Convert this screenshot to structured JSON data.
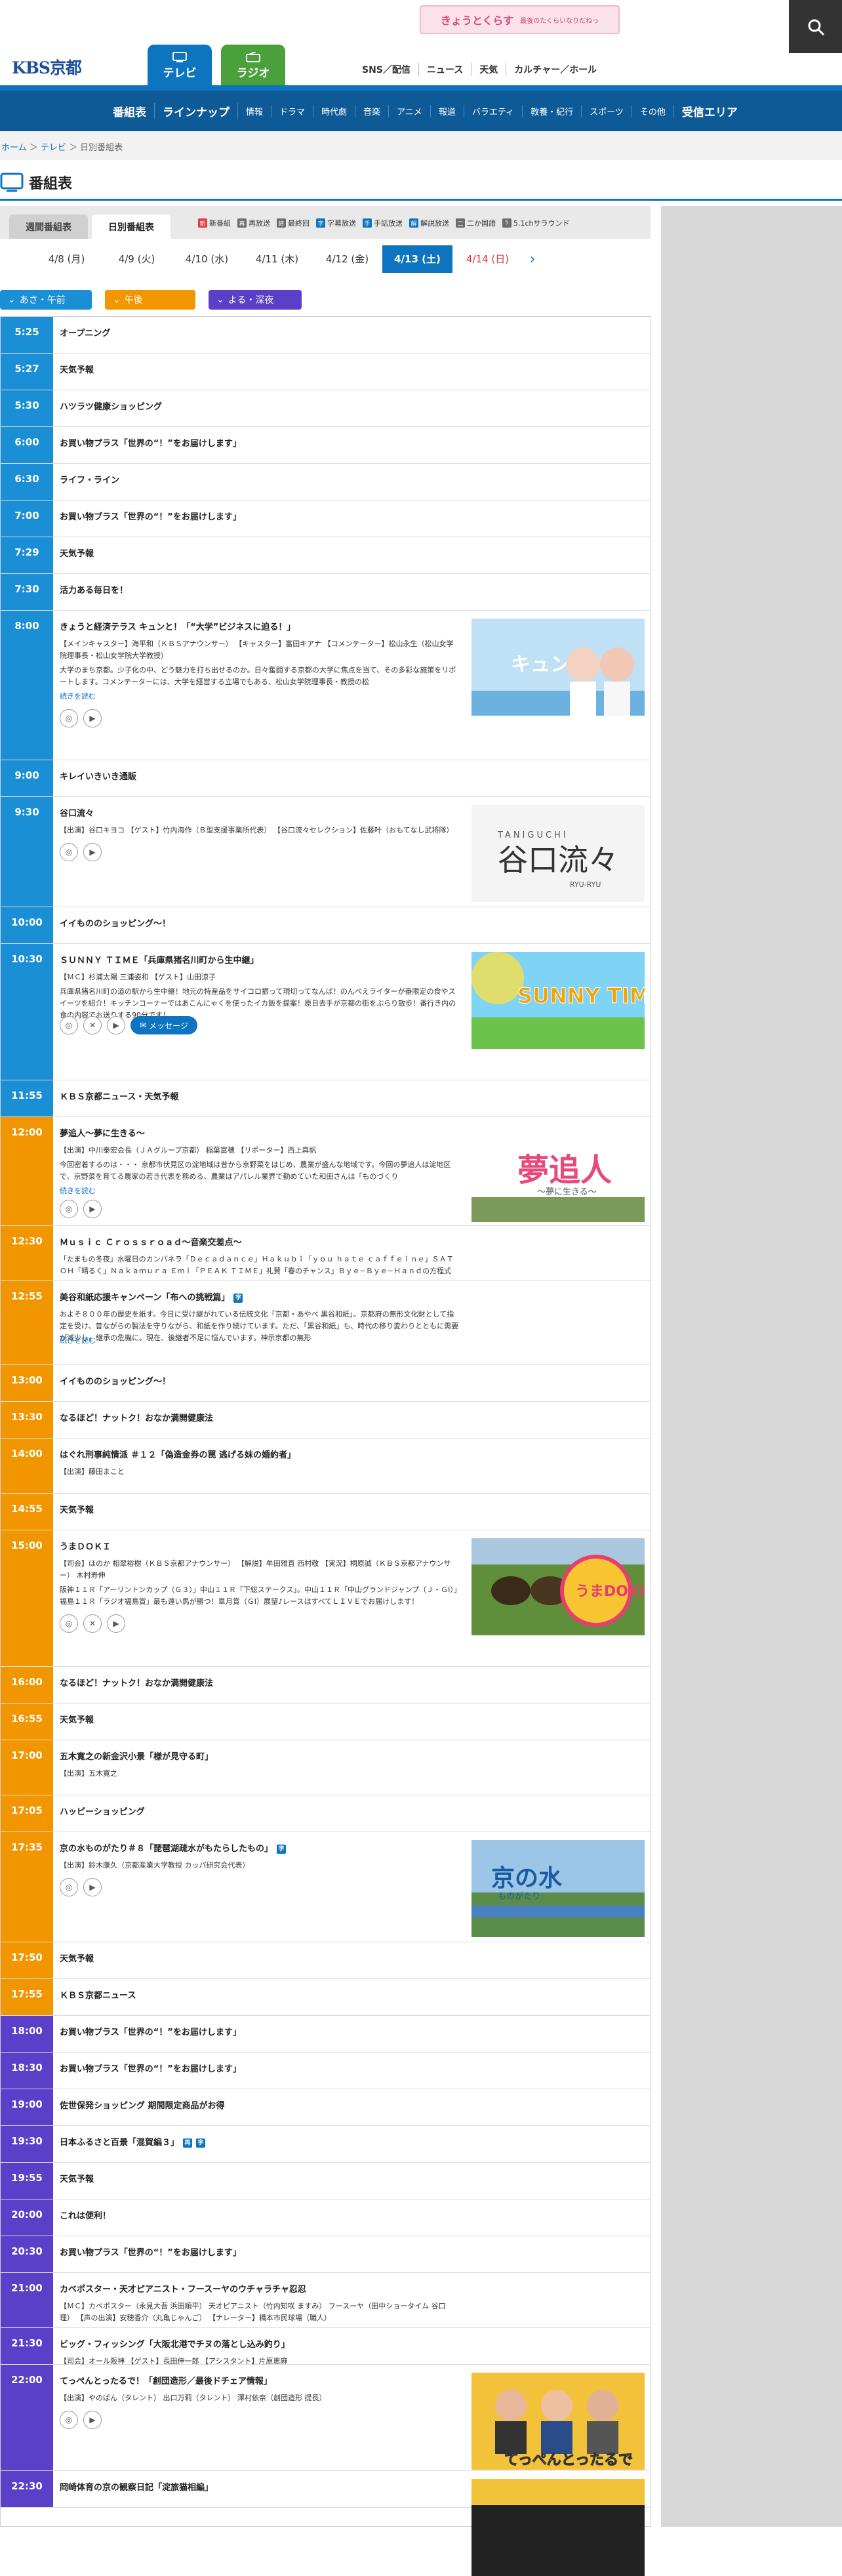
{
  "header": {
    "banner_main": "きょうとくらす",
    "banner_sub": "最後のたくらいなりだねっ",
    "logo": "KBS京都",
    "tab_tv": "テレビ",
    "tab_radio": "ラジオ",
    "nav": [
      "SNS／配信",
      "ニュース",
      "天気",
      "カルチャー／ホール"
    ]
  },
  "category_nav": [
    "番組表",
    "ラインナップ",
    "情報",
    "ドラマ",
    "時代劇",
    "音楽",
    "アニメ",
    "報道",
    "バラエティ",
    "教養・紀行",
    "スポーツ",
    "その他",
    "受信エリア"
  ],
  "breadcrumb": [
    "ホーム",
    "テレビ",
    "日別番組表"
  ],
  "page_title": "番組表",
  "sub_tabs": [
    "週間番組表",
    "日別番組表"
  ],
  "legend": [
    {
      "mark": "新",
      "label": "新番組",
      "color": "#e8383d"
    },
    {
      "mark": "再",
      "label": "再放送",
      "color": "#6c6c6c"
    },
    {
      "mark": "終",
      "label": "最終回",
      "color": "#6c6c6c"
    },
    {
      "mark": "字",
      "label": "字幕放送",
      "color": "#0d74c0"
    },
    {
      "mark": "手",
      "label": "手話放送",
      "color": "#0d74c0"
    },
    {
      "mark": "解",
      "label": "解説放送",
      "color": "#0d74c0"
    },
    {
      "mark": "二",
      "label": "二か国語",
      "color": "#6c6c6c"
    },
    {
      "mark": "5",
      "label": "5.1chサラウンド",
      "color": "#6c6c6c"
    }
  ],
  "dates": [
    "4/8 (月)",
    "4/9 (火)",
    "4/10 (水)",
    "4/11 (木)",
    "4/12 (金)",
    "4/13 (土)",
    "4/14 (日)"
  ],
  "time_filters": [
    {
      "label": "あさ・午前",
      "color": "#1a8fd6"
    },
    {
      "label": "午後",
      "color": "#f29600"
    },
    {
      "label": "よる・深夜",
      "color": "#5a3fc8"
    }
  ],
  "icon_labels": {
    "message": "メッセージ",
    "read_more": "続きを読む"
  },
  "programs": [
    {
      "time": "5:25",
      "title": "オープニング",
      "band": "am"
    },
    {
      "time": "5:27",
      "title": "天気予報",
      "band": "am"
    },
    {
      "time": "5:30",
      "title": "ハツラツ健康ショッピング",
      "band": "am"
    },
    {
      "time": "6:00",
      "title": "お買い物プラス「世界の“！”をお届けします」",
      "band": "am"
    },
    {
      "time": "6:30",
      "title": "ライフ・ライン",
      "band": "am"
    },
    {
      "time": "7:00",
      "title": "お買い物プラス「世界の“！”をお届けします」",
      "band": "am"
    },
    {
      "time": "7:29",
      "title": "天気予報",
      "band": "am"
    },
    {
      "time": "7:30",
      "title": "活力ある毎日を！",
      "band": "am"
    },
    {
      "time": "8:00",
      "title": "きょうと経済テラス キュンと！「“大学”ビジネスに迫る！」",
      "band": "am",
      "desc": "【メインキャスター】海平和（ＫＢＳアナウンサー） 【キャスター】富田キアナ 【コメンテーター】松山永生（松山女学院理事長・松山女学院大学教授）",
      "desc2": "大学のまち京都。少子化の中、どう魅力を打ち出せるのか。日々奮闘する京都の大学に焦点を当て、その多彩な施策をリポートします。コメンテーターには、大学を経営する立場でもある、松山女学院理事長・教授の松",
      "more": true,
      "thumb": "kyun"
    },
    {
      "time": "9:00",
      "title": "キレイいきいき通販",
      "band": "am"
    },
    {
      "time": "9:30",
      "title": "谷口流々",
      "band": "am",
      "desc": "【出演】谷口キヨコ 【ゲスト】竹内海作（Ｂ型支援事業所代表） 【谷口流々セレクション】佐藤叶（おもてなし武将隊）",
      "thumb": "taniguchi",
      "thumb_text": "谷口流々",
      "thumb_top": "TANIGUCHI",
      "thumb_bottom": "RYU-RYU"
    },
    {
      "time": "10:00",
      "title": "イイもののショッピング〜！",
      "band": "am"
    },
    {
      "time": "10:30",
      "title": "ＳＵＮＮＹ ＴＩＭＥ「兵庫県猪名川町から生中継」",
      "band": "am",
      "desc": "【ＭＣ】杉浦太陽 三浦姿和 【ゲスト】山田涼子",
      "desc2": "兵庫県猪名川町の道の駅から生中継！地元の特産品をサイコロ振って現切ってなんば！のんべえライターが番限定の食やスイーツを紹介！キッチンコーナーではあこんにゃくを使ったイカ飯を提案！原日去手が京都の街をぶらり散歩！番行き内の食の内容でお送りする90分です！",
      "thumb": "sunny",
      "thumb_text": "SUNNY TIME"
    },
    {
      "time": "11:55",
      "title": "ＫＢＳ京都ニュース・天気予報",
      "band": "am"
    },
    {
      "time": "12:00",
      "title": "夢追人〜夢に生きる〜",
      "band": "pm",
      "desc": "【出演】中川泰宏会長（ＪＡグループ京都） 稲葉富穂 【リポーター】西上真帆",
      "desc2": "今回密着するのは・・・ 京都市伏見区の淀地域は昔から京野菜をはじめ、農業が盛んな地域です。今回の夢追人は淀地区で、京野菜を育てる農家の若き代表を務める、農業はアパレル業界で勤めていた和田さんは「ものづくり",
      "more": true,
      "thumb": "yume",
      "thumb_text": "夢追人",
      "thumb_sub": "〜夢に生きる〜"
    },
    {
      "time": "12:30",
      "title": "Ｍｕｓｉｃ Ｃｒｏｓｓｒｏａｄ〜音楽交差点〜",
      "band": "pm",
      "desc": "「たまもの冬夜」水曜日のカンパネラ「Ｄｅｃａｄａｎｃｅ」Ｈａｋｕｂｉ「ｙｏｕ ｈａｔｅ ｃａｆｆｅｉｎｅ」ＳＡＴＯＨ「晴るく」Ｎａｋａｍｕｒａ Ｅｍｉ「ＰＥＡＫ ＴＩＭＥ」礼賛「春のチャンス」Ｂｙｅ−Ｂｙｅ−Ｈａｎｄの方程式"
    },
    {
      "time": "12:55",
      "title": "美谷和紙応援キャンペーン「布への挑戦篇」",
      "band": "pm",
      "desc": "およそ８００年の歴史を紙す。今日に受け継がれている伝統文化「京都・あやべ 黒谷和紙」。京都府の無形文化財として指定を受け、昔ながらの製法を守りながら、和紙を作り続けています。ただ、「黒谷和紙」も、時代の移り変わりとともに需要が減少し、継承の危機に。現在、後継者不足に悩んでいます。神示京都の無形",
      "more": true,
      "badge": true
    },
    {
      "time": "13:00",
      "title": "イイもののショッピング〜！",
      "band": "pm"
    },
    {
      "time": "13:30",
      "title": "なるほど！ナットク！おなか満開健康法",
      "band": "pm"
    },
    {
      "time": "14:00",
      "title": "はぐれ刑事純情派 ＃１２「偽造金券の罠 逃げる妹の婚約者」",
      "band": "pm",
      "desc": "【出演】藤田まこと"
    },
    {
      "time": "14:55",
      "title": "天気予報",
      "band": "pm"
    },
    {
      "time": "15:00",
      "title": "うまＤＯＫＩ",
      "band": "pm",
      "desc": "【司会】ほのか 相翠裕樹（ＫＢＳ京都アナウンサー） 【解説】牟田雅直 西村敬 【実況】桐原誠（ＫＢＳ京都アナウンサー） 木村寿伸",
      "desc2": "阪神１１Ｒ「アーリントンカップ（Ｇ３）」中山１１Ｒ「下総ステークス」。中山１１Ｒ「中山グランドジャンプ（Ｊ・ＧⅠ）」福島１１Ｒ「ラジオ福島賞」最も遠い馬が勝つ！皐月賞（ＧⅠ）展望♪レースはすべてＬＩＶＥでお届けします！",
      "thumb": "uma",
      "thumb_text": "うまDOKI"
    },
    {
      "time": "16:00",
      "title": "なるほど！ナットク！おなか満開健康法",
      "band": "pm"
    },
    {
      "time": "16:55",
      "title": "天気予報",
      "band": "pm"
    },
    {
      "time": "17:00",
      "title": "五木寛之の新金沢小景「様が見守る町」",
      "band": "pm",
      "desc": "【出演】五木寛之"
    },
    {
      "time": "17:05",
      "title": "ハッピーショッピング",
      "band": "pm"
    },
    {
      "time": "17:35",
      "title": "京の水ものがたり＃８「琵琶湖疏水がもたらしたもの」",
      "band": "pm",
      "desc": "【出演】鈴木康久（京都産業大学教授 カッパ研究会代表）",
      "badge": true,
      "thumb": "kyomizu",
      "thumb_text": "京の水",
      "thumb_sub": "ものがたり"
    },
    {
      "time": "17:50",
      "title": "天気予報",
      "band": "pm"
    },
    {
      "time": "17:55",
      "title": "ＫＢＳ京都ニュース",
      "band": "pm"
    },
    {
      "time": "18:00",
      "title": "お買い物プラス「世界の“！”をお届けします」",
      "band": "night"
    },
    {
      "time": "18:30",
      "title": "お買い物プラス「世界の“！”をお届けします」",
      "band": "night"
    },
    {
      "time": "19:00",
      "title": "佐世保発ショッピング 期間限定商品がお得",
      "band": "night"
    },
    {
      "time": "19:30",
      "title": "日本ふるさと百景「混賀編３」",
      "band": "night",
      "badge2": true
    },
    {
      "time": "19:55",
      "title": "天気予報",
      "band": "night"
    },
    {
      "time": "20:00",
      "title": "これは便利！",
      "band": "night"
    },
    {
      "time": "20:30",
      "title": "お買い物プラス「世界の“！”をお届けします」",
      "band": "night"
    },
    {
      "time": "21:00",
      "title": "カベポスター・天才ピアニスト・フースーヤのウチャラチャ忍忍",
      "band": "night",
      "desc": "【ＭＣ】カベポスター（永見大吾 浜田順平） 天才ピアニスト（竹内知咲 ますみ） フースーヤ（田中ショータイム 谷口理） 【声の出演】安穂香介（丸亀じゃんご） 【ナレーター】橋本市民球場（職人）"
    },
    {
      "time": "21:30",
      "title": "ビッグ・フィッシング「大阪北港でチヌの落とし込み釣り」",
      "band": "night",
      "desc": "【司会】オール阪神 【ゲスト】長田伸一郎 【アシスタント】片原恵麻"
    },
    {
      "time": "22:00",
      "title": "てっぺんとったるで！「創団造形／最後ドチェア情報」",
      "band": "night",
      "desc": "【出演】やのばん（タレント） 出口万莉（タレント） 澤村依奈（創団造形 提長）",
      "thumb": "teppen",
      "thumb_text": "てっぺんとったるで"
    },
    {
      "time": "22:30",
      "title": "岡崎体育の京の観察日記「淀旅猫相編」",
      "band": "night",
      "thumb": "okazaki"
    }
  ]
}
